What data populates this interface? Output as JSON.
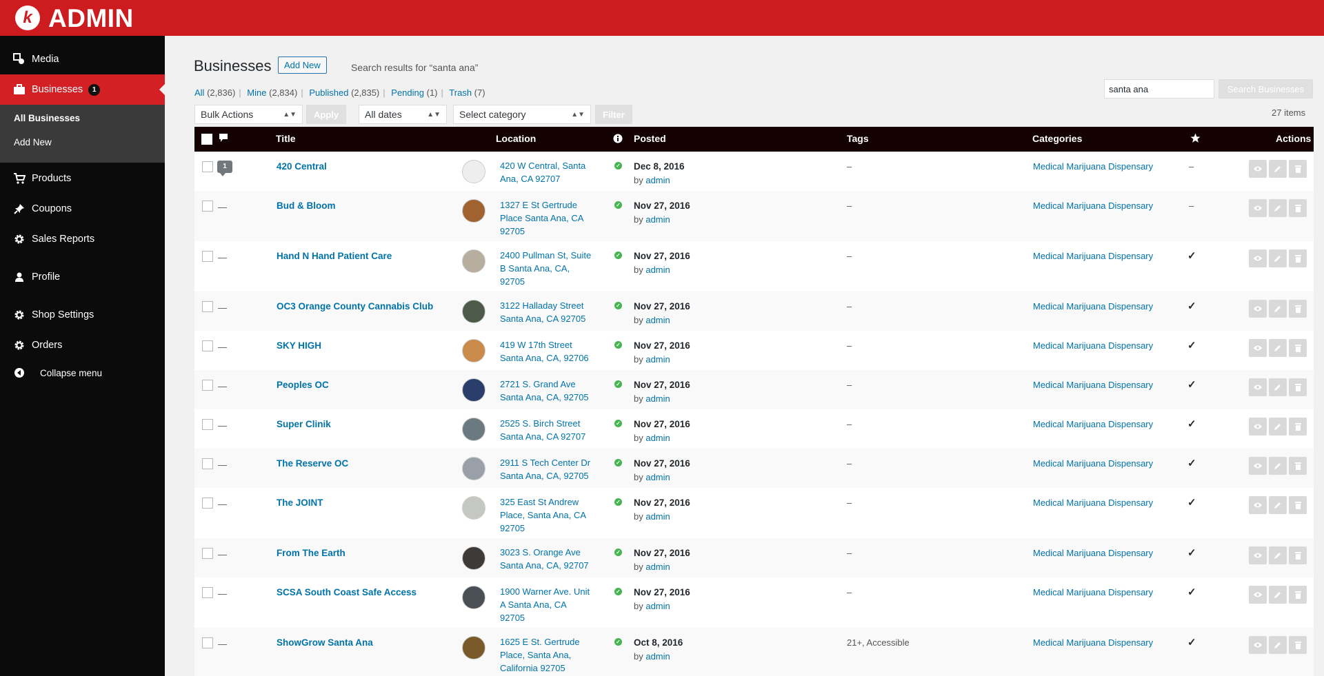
{
  "brand": {
    "logo_letter": "k",
    "name": "ADMIN"
  },
  "sidebar": {
    "items": [
      {
        "label": "Media",
        "icon": "media-icon"
      },
      {
        "label": "Businesses",
        "icon": "briefcase-icon",
        "badge": "1"
      },
      {
        "label": "Products",
        "icon": "cart-icon"
      },
      {
        "label": "Coupons",
        "icon": "pin-icon"
      },
      {
        "label": "Sales Reports",
        "icon": "gear-icon"
      },
      {
        "label": "Profile",
        "icon": "user-icon"
      },
      {
        "label": "Shop Settings",
        "icon": "gear-icon"
      },
      {
        "label": "Orders",
        "icon": "gear-icon"
      },
      {
        "label": "Collapse menu",
        "icon": "collapse-icon"
      }
    ],
    "submenu": {
      "all": "All Businesses",
      "add": "Add New"
    }
  },
  "page": {
    "title": "Businesses",
    "add_new": "Add New",
    "subtitle": "Search results for “santa ana”",
    "views": {
      "all": "All",
      "all_count": "(2,836)",
      "mine": "Mine",
      "mine_count": "(2,834)",
      "published": "Published",
      "published_count": "(2,835)",
      "pending": "Pending",
      "pending_count": "(1)",
      "trash": "Trash",
      "trash_count": "(7)"
    },
    "search_value": "santa ana",
    "search_button": "Search Businesses",
    "items_count": "27 items",
    "bulk_actions": "Bulk Actions",
    "apply": "Apply",
    "all_dates": "All dates",
    "select_category": "Select category",
    "filter": "Filter"
  },
  "table": {
    "headers": {
      "title": "Title",
      "location": "Location",
      "posted": "Posted",
      "tags": "Tags",
      "categories": "Categories",
      "actions": "Actions"
    },
    "rows": [
      {
        "title": "420 Central",
        "comment": "1",
        "loc1": "420 W Central, Santa",
        "loc2": "Ana, CA 92707",
        "loc3": "",
        "date": "Dec 8, 2016",
        "by": "admin",
        "tags": "–",
        "cat": "Medical Marijuana Dispensary",
        "featured": "–",
        "thumb": "#eeeeee"
      },
      {
        "title": "Bud & Bloom",
        "comment": "—",
        "loc1": "1327 E St Gertrude",
        "loc2": "Place Santa Ana, CA",
        "loc3": "92705",
        "date": "Nov 27, 2016",
        "by": "admin",
        "tags": "–",
        "cat": "Medical Marijuana Dispensary",
        "featured": "–",
        "thumb": "#a0622e"
      },
      {
        "title": "Hand N Hand Patient Care",
        "comment": "—",
        "loc1": "2400 Pullman St, Suite",
        "loc2": "B Santa Ana, CA,",
        "loc3": "92705",
        "date": "Nov 27, 2016",
        "by": "admin",
        "tags": "–",
        "cat": "Medical Marijuana Dispensary",
        "featured": "✓",
        "thumb": "#b8ae9f"
      },
      {
        "title": "OC3 Orange County Cannabis Club",
        "comment": "—",
        "loc1": "3122 Halladay Street",
        "loc2": "Santa Ana, CA 92705",
        "loc3": "",
        "date": "Nov 27, 2016",
        "by": "admin",
        "tags": "–",
        "cat": "Medical Marijuana Dispensary",
        "featured": "✓",
        "thumb": "#4d5a4a"
      },
      {
        "title": "SKY HIGH",
        "comment": "—",
        "loc1": "419 W 17th Street",
        "loc2": "Santa Ana, CA, 92706",
        "loc3": "",
        "date": "Nov 27, 2016",
        "by": "admin",
        "tags": "–",
        "cat": "Medical Marijuana Dispensary",
        "featured": "✓",
        "thumb": "#c98a4a"
      },
      {
        "title": "Peoples OC",
        "comment": "—",
        "loc1": "2721 S. Grand Ave",
        "loc2": "Santa Ana, CA, 92705",
        "loc3": "",
        "date": "Nov 27, 2016",
        "by": "admin",
        "tags": "–",
        "cat": "Medical Marijuana Dispensary",
        "featured": "✓",
        "thumb": "#2a3d6b"
      },
      {
        "title": "Super Clinik",
        "comment": "—",
        "loc1": "2525 S. Birch Street",
        "loc2": "Santa Ana, CA 92707",
        "loc3": "",
        "date": "Nov 27, 2016",
        "by": "admin",
        "tags": "–",
        "cat": "Medical Marijuana Dispensary",
        "featured": "✓",
        "thumb": "#6b7a80"
      },
      {
        "title": "The Reserve OC",
        "comment": "—",
        "loc1": "2911 S Tech Center Dr",
        "loc2": "Santa Ana, CA, 92705",
        "loc3": "",
        "date": "Nov 27, 2016",
        "by": "admin",
        "tags": "–",
        "cat": "Medical Marijuana Dispensary",
        "featured": "✓",
        "thumb": "#9aa0a8"
      },
      {
        "title": "The JOINT",
        "comment": "—",
        "loc1": "325 East St Andrew",
        "loc2": "Place, Santa Ana, CA",
        "loc3": "92705",
        "date": "Nov 27, 2016",
        "by": "admin",
        "tags": "–",
        "cat": "Medical Marijuana Dispensary",
        "featured": "✓",
        "thumb": "#c5c8c2"
      },
      {
        "title": "From The Earth",
        "comment": "—",
        "loc1": "3023 S. Orange Ave",
        "loc2": "Santa Ana, CA, 92707",
        "loc3": "",
        "date": "Nov 27, 2016",
        "by": "admin",
        "tags": "–",
        "cat": "Medical Marijuana Dispensary",
        "featured": "✓",
        "thumb": "#3d3a38"
      },
      {
        "title": "SCSA South Coast Safe Access",
        "comment": "—",
        "loc1": "1900 Warner Ave. Unit",
        "loc2": "A Santa Ana, CA",
        "loc3": "92705",
        "date": "Nov 27, 2016",
        "by": "admin",
        "tags": "–",
        "cat": "Medical Marijuana Dispensary",
        "featured": "✓",
        "thumb": "#4a4e55"
      },
      {
        "title": "ShowGrow Santa Ana",
        "comment": "—",
        "loc1": "1625 E St. Gertrude",
        "loc2": "Place, Santa Ana,",
        "loc3": "California 92705",
        "date": "Oct 8, 2016",
        "by": "admin",
        "tags": "21+, Accessible",
        "cat": "Medical Marijuana Dispensary",
        "featured": "✓",
        "thumb": "#7a5a2a"
      }
    ]
  },
  "colors": {
    "brand_red": "#cd1c1f",
    "link_blue": "#0073aa",
    "status_green": "#46b450"
  }
}
